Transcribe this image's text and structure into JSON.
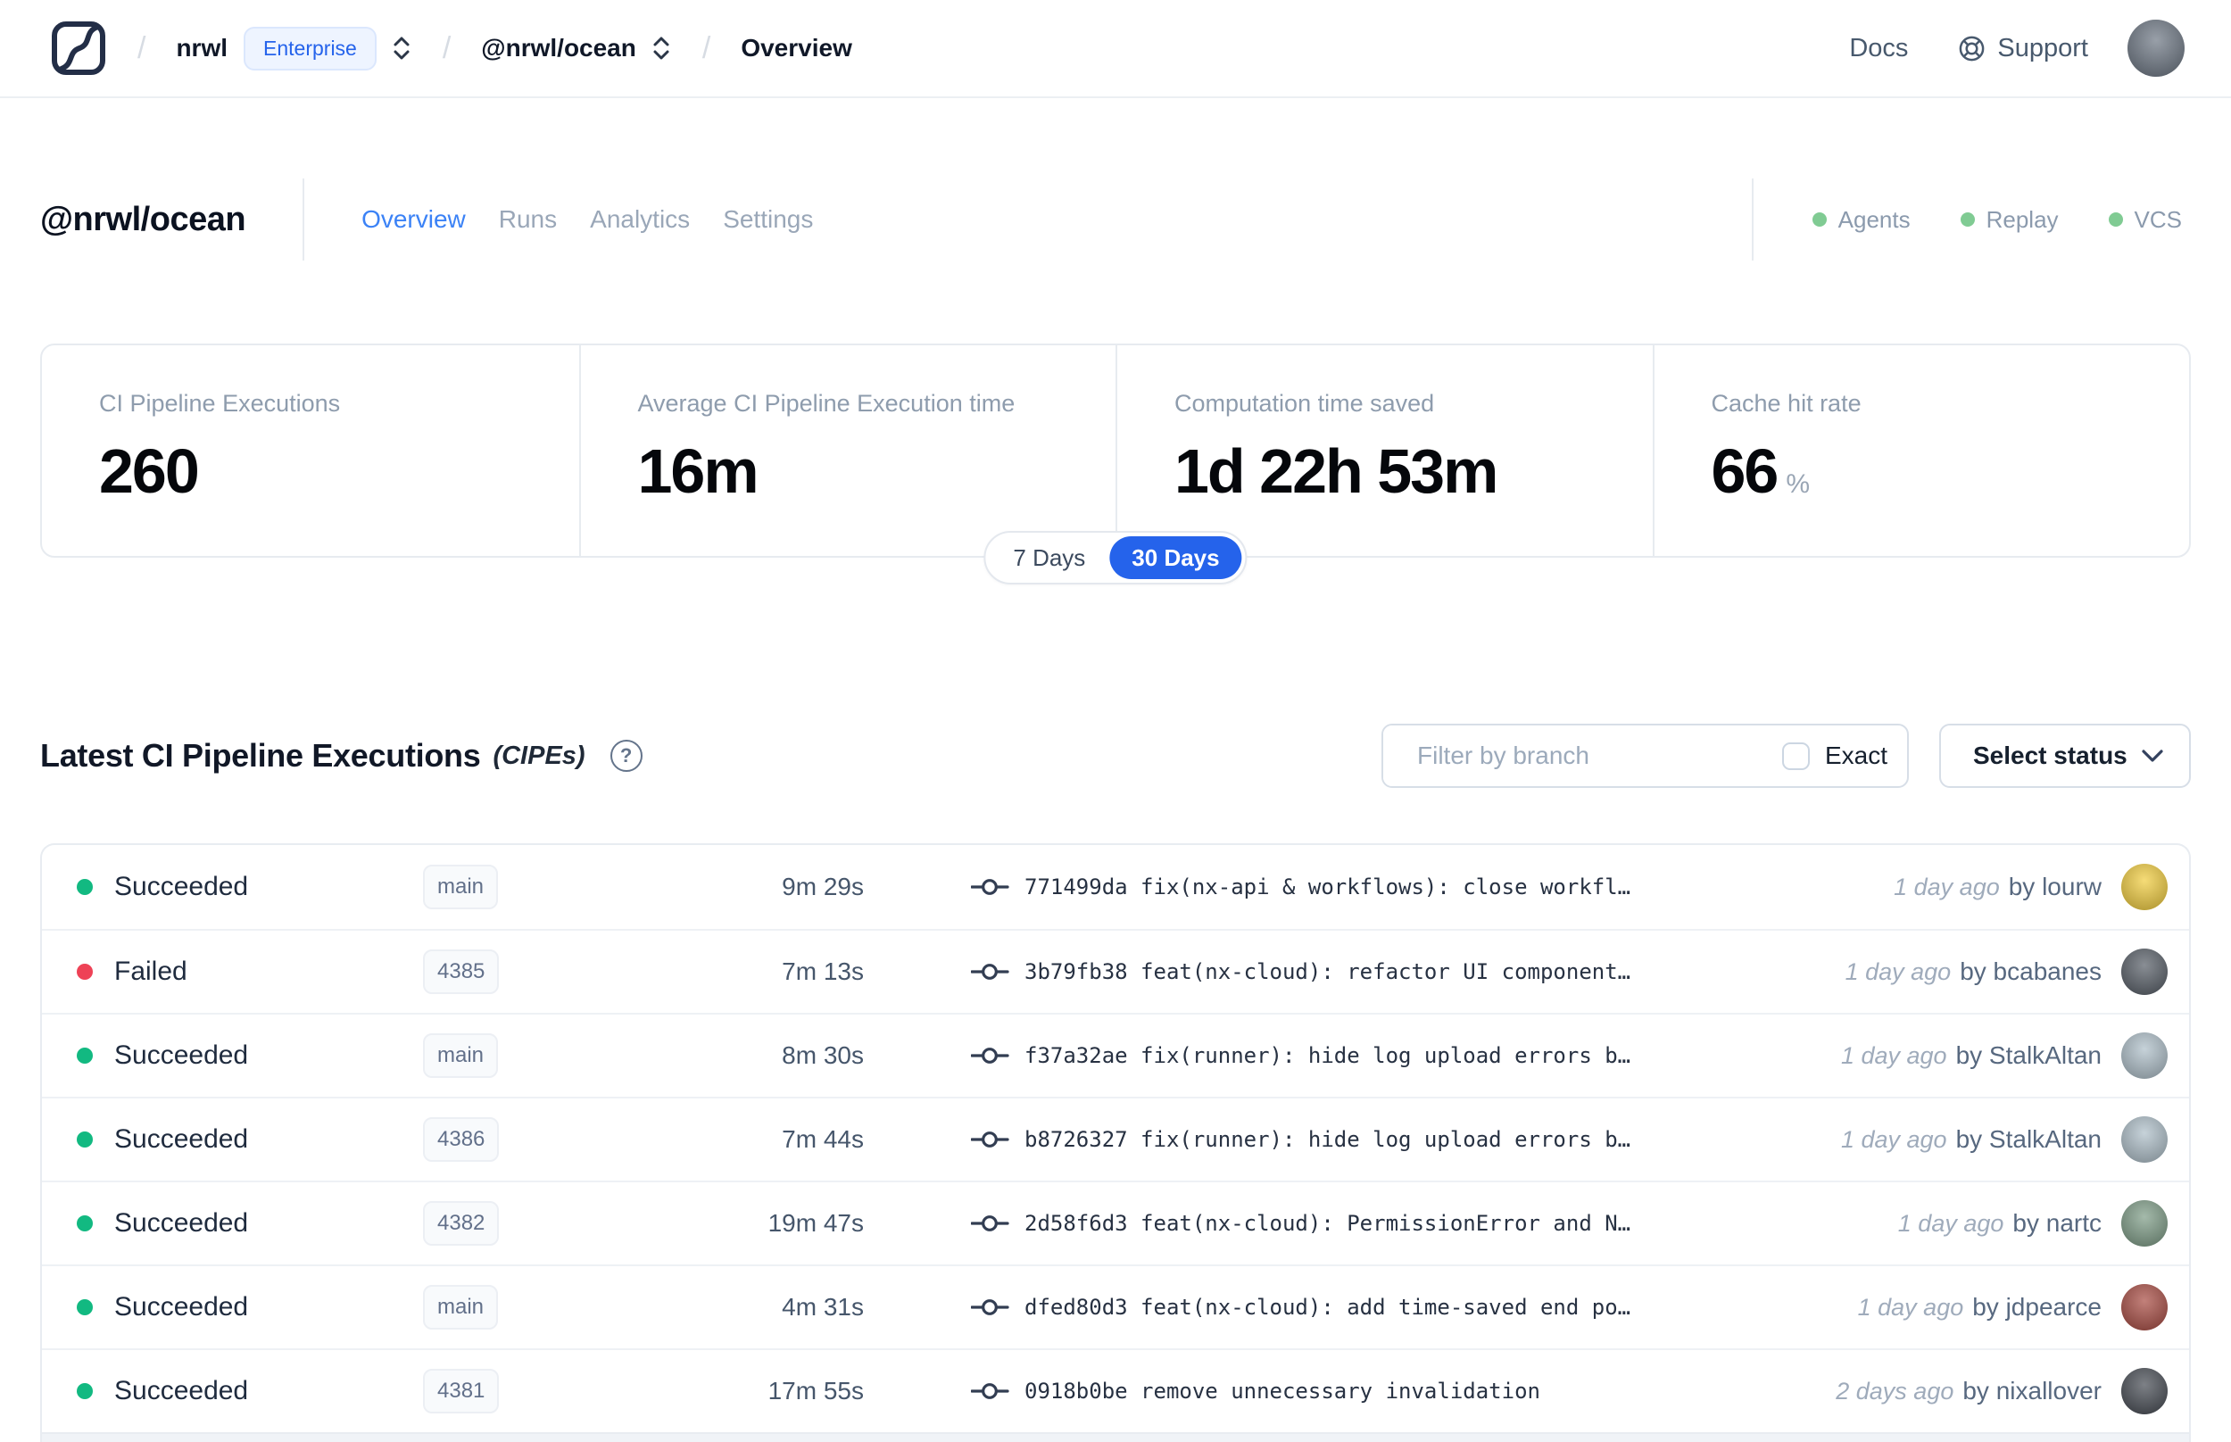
{
  "navbar": {
    "separator": "/",
    "org": "nrwl",
    "plan_badge": "Enterprise",
    "workspace": "@nrwl/ocean",
    "page": "Overview",
    "docs": "Docs",
    "support": "Support"
  },
  "header": {
    "title": "@nrwl/ocean",
    "tabs": [
      {
        "label": "Overview",
        "active": true
      },
      {
        "label": "Runs",
        "active": false
      },
      {
        "label": "Analytics",
        "active": false
      },
      {
        "label": "Settings",
        "active": false
      }
    ],
    "services": [
      {
        "label": "Agents"
      },
      {
        "label": "Replay"
      },
      {
        "label": "VCS"
      }
    ]
  },
  "stats": {
    "cards": [
      {
        "label": "CI Pipeline Executions",
        "value": "260",
        "suffix": ""
      },
      {
        "label": "Average CI Pipeline Execution time",
        "value": "16m",
        "suffix": ""
      },
      {
        "label": "Computation time saved",
        "value": "1d 22h 53m",
        "suffix": ""
      },
      {
        "label": "Cache hit rate",
        "value": "66",
        "suffix": "%"
      }
    ],
    "range_toggle": {
      "options": [
        "7 Days",
        "30 Days"
      ],
      "selected": "30 Days"
    }
  },
  "cipe": {
    "title": "Latest CI Pipeline Executions",
    "title_suffix": "(CIPEs)",
    "help_glyph": "?",
    "filter_placeholder": "Filter by branch",
    "exact_label": "Exact",
    "status_select_label": "Select status",
    "rows": [
      {
        "status": "Succeeded",
        "branch": "main",
        "duration": "9m 29s",
        "commit": "771499da fix(nx-api & workflows): close workfl…",
        "time": "1 day ago",
        "author": "by lourw",
        "avatar_color": "#f2cd3d"
      },
      {
        "status": "Failed",
        "branch": "4385",
        "duration": "7m 13s",
        "commit": "3b79fb38 feat(nx-cloud): refactor UI component…",
        "time": "1 day ago",
        "author": "by bcabanes",
        "avatar_color": "#565d66"
      },
      {
        "status": "Succeeded",
        "branch": "main",
        "duration": "8m 30s",
        "commit": "f37a32ae fix(runner): hide log upload errors b…",
        "time": "1 day ago",
        "author": "by StalkAltan",
        "avatar_color": "#aebfc9"
      },
      {
        "status": "Succeeded",
        "branch": "4386",
        "duration": "7m 44s",
        "commit": "b8726327 fix(runner): hide log upload errors b…",
        "time": "1 day ago",
        "author": "by StalkAltan",
        "avatar_color": "#aebfc9"
      },
      {
        "status": "Succeeded",
        "branch": "4382",
        "duration": "19m 47s",
        "commit": "2d58f6d3 feat(nx-cloud): PermissionError and N…",
        "time": "1 day ago",
        "author": "by nartc",
        "avatar_color": "#7d9c86"
      },
      {
        "status": "Succeeded",
        "branch": "main",
        "duration": "4m 31s",
        "commit": "dfed80d3 feat(nx-cloud): add time-saved end po…",
        "time": "1 day ago",
        "author": "by jdpearce",
        "avatar_color": "#a84a41"
      },
      {
        "status": "Succeeded",
        "branch": "4381",
        "duration": "17m 55s",
        "commit": "0918b0be remove unnecessary invalidation",
        "time": "2 days ago",
        "author": "by nixallover",
        "avatar_color": "#454a52"
      }
    ]
  },
  "colors": {
    "accent_blue": "#2563eb",
    "tab_active_blue": "#3b82f6",
    "succeeded_green": "#12b981",
    "failed_red": "#ee4256",
    "service_dot_green": "#80cb93",
    "nav_avatar": "#6c7683"
  }
}
